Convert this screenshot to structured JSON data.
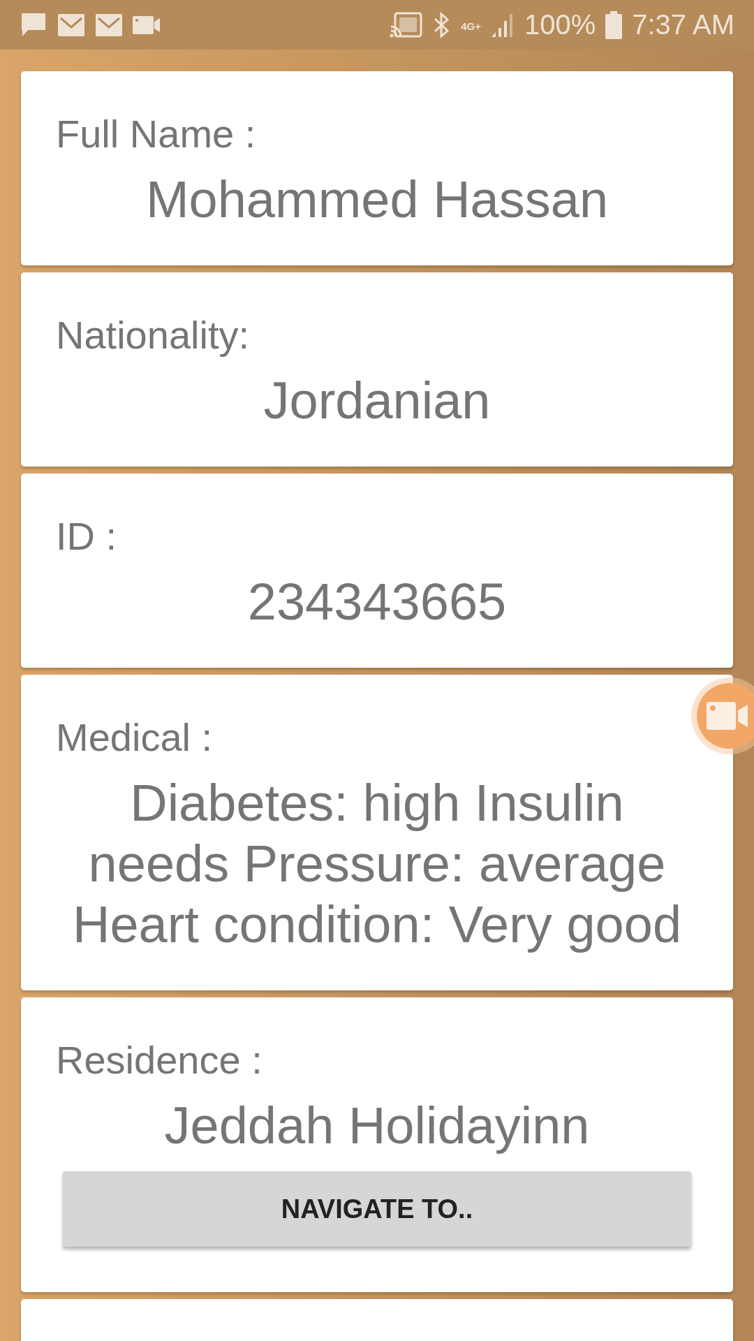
{
  "status_bar": {
    "network": "4G+",
    "battery": "100%",
    "time": "7:37 AM"
  },
  "cards": [
    {
      "label": "Full Name :",
      "value": "Mohammed Hassan"
    },
    {
      "label": "Nationality:",
      "value": "Jordanian"
    },
    {
      "label": "ID :",
      "value": "234343665"
    },
    {
      "label": "Medical :",
      "value": "Diabetes: high Insulin needs Pressure: average Heart condition: Very good"
    },
    {
      "label": "Residence :",
      "value": "Jeddah Holidayinn",
      "button": "NAVIGATE TO.."
    }
  ]
}
